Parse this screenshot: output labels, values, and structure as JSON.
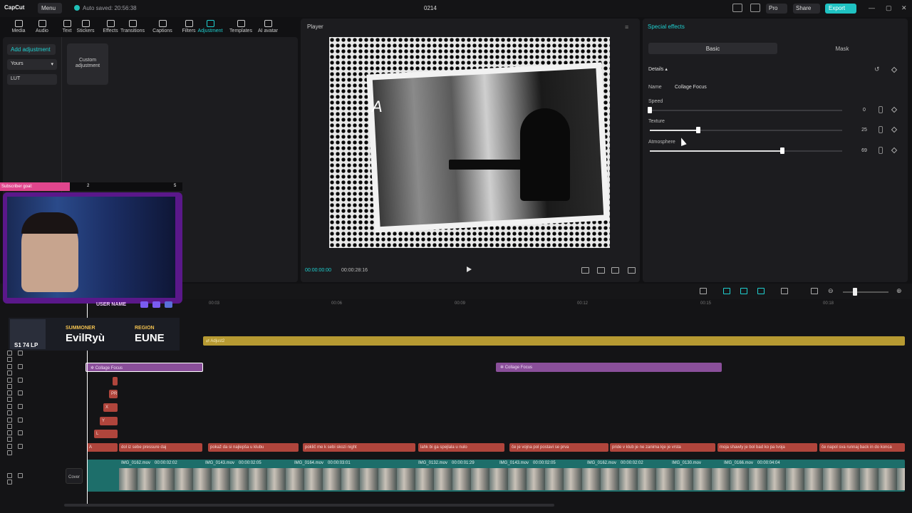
{
  "app": {
    "logo": "CapCut",
    "menu_label": "Menu",
    "autosave": "Auto saved: 20:56:38",
    "title": "0214",
    "pro": "Pro",
    "share": "Share",
    "export": "Export"
  },
  "toolbar": {
    "items": [
      {
        "label": "Media"
      },
      {
        "label": "Audio"
      },
      {
        "label": "Text"
      },
      {
        "label": "Stickers"
      },
      {
        "label": "Effects"
      },
      {
        "label": "Transitions"
      },
      {
        "label": "Captions"
      },
      {
        "label": "Filters"
      },
      {
        "label": "Adjustment"
      },
      {
        "label": "Templates"
      },
      {
        "label": "AI avatar"
      }
    ],
    "active": "Adjustment"
  },
  "left_panel": {
    "add_adjustment": "Add adjustment",
    "yours": "Yours",
    "lut": "LUT",
    "custom_adjustment": "Custom adjustment"
  },
  "player": {
    "title": "Player",
    "current_time": "00:00:00:00",
    "total_time": "00:00:28:16",
    "overlay_letter": "A"
  },
  "effects_panel": {
    "title": "Special effects",
    "tabs": [
      "Basic",
      "Mask"
    ],
    "active_tab": "Basic",
    "section": "Details",
    "name_label": "Name",
    "name_value": "Collage Focus",
    "params": [
      {
        "label": "Speed",
        "value": "0",
        "level": 0
      },
      {
        "label": "Texture",
        "value": "25",
        "level": 25
      },
      {
        "label": "Atmosphere",
        "value": "69",
        "level": 69
      }
    ]
  },
  "timeline": {
    "ruler": [
      "00:03",
      "00:06",
      "00:09",
      "00:12",
      "00:15",
      "00:18"
    ],
    "adjust_clip": "Adjust2",
    "fx_clips": [
      "Collage Focus",
      "Collage Focus"
    ],
    "small_text_clips": [
      "PR",
      "X",
      "Y",
      "L"
    ],
    "caption_clips": [
      "A",
      "dol iz sebe pressure daj",
      "pokaž da si najlepša u klubu",
      "poklič me k sebi skozi night",
      "lahk bi ga spejlala u nulo",
      "če je vojna pol postavi se prva",
      "pride v klub je ne zanima kje je vrsta",
      "moja shawty je bol bad ko pa tvoja",
      "če napol sva runnaj back in do konca"
    ],
    "video_segments": [
      {
        "name": "IMG_0162.mov",
        "duration": "00:00:02:02"
      },
      {
        "name": "IMG_0143.mov",
        "duration": "00:00:02:05"
      },
      {
        "name": "IMG_0164.mov",
        "duration": "00:00:03:01"
      },
      {
        "name": "IMG_0132.mov",
        "duration": "00:00:01:29"
      },
      {
        "name": "IMG_0143.mov",
        "duration": "00:00:02:05"
      },
      {
        "name": "IMG_0162.mov",
        "duration": "00:00:02:02"
      },
      {
        "name": "IMG_0130.mov",
        "duration": ""
      },
      {
        "name": "IMG_0166.mov",
        "duration": "00:00:04:04"
      }
    ],
    "cover_label": "Cover"
  },
  "overlay": {
    "subscriber_goal": "Subscriber goal:",
    "goal_current": "2",
    "goal_max": "5",
    "username": "USER NAME",
    "summoner_label": "SUMMONER",
    "summoner_name": "EvilRyù",
    "region_label": "REGION",
    "region_name": "EUNE",
    "lp": "S1 74 LP"
  },
  "colors": {
    "accent": "#1fd0d0",
    "adjust_clip": "#b79a32",
    "fx_clip": "#8a4f9a",
    "text_clip": "#b0453c",
    "video_track": "#1d6e6a"
  }
}
